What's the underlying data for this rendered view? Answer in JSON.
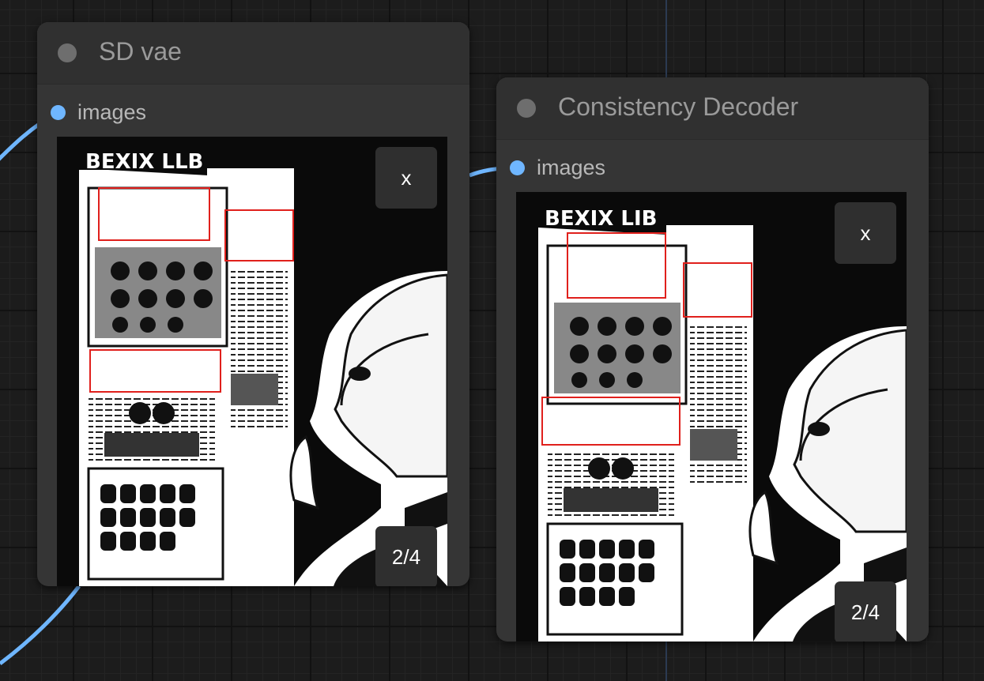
{
  "canvas": {
    "link_color": "#6fb6ff",
    "slot_color": "#6fb6ff",
    "status_dot_color": "#6e6e6e"
  },
  "nodes": [
    {
      "title": "SD vae",
      "status_icon": "status-dot",
      "input_slot": {
        "label": "images"
      },
      "preview": {
        "masthead": "BEXIX LLB",
        "close_label": "x",
        "counter": "2/4",
        "highlight_color": "#e0201c"
      }
    },
    {
      "title": "Consistency Decoder",
      "status_icon": "status-dot",
      "input_slot": {
        "label": "images"
      },
      "preview": {
        "masthead": "BEXIX LIB",
        "close_label": "x",
        "counter": "2/4",
        "highlight_color": "#e0201c"
      }
    }
  ]
}
